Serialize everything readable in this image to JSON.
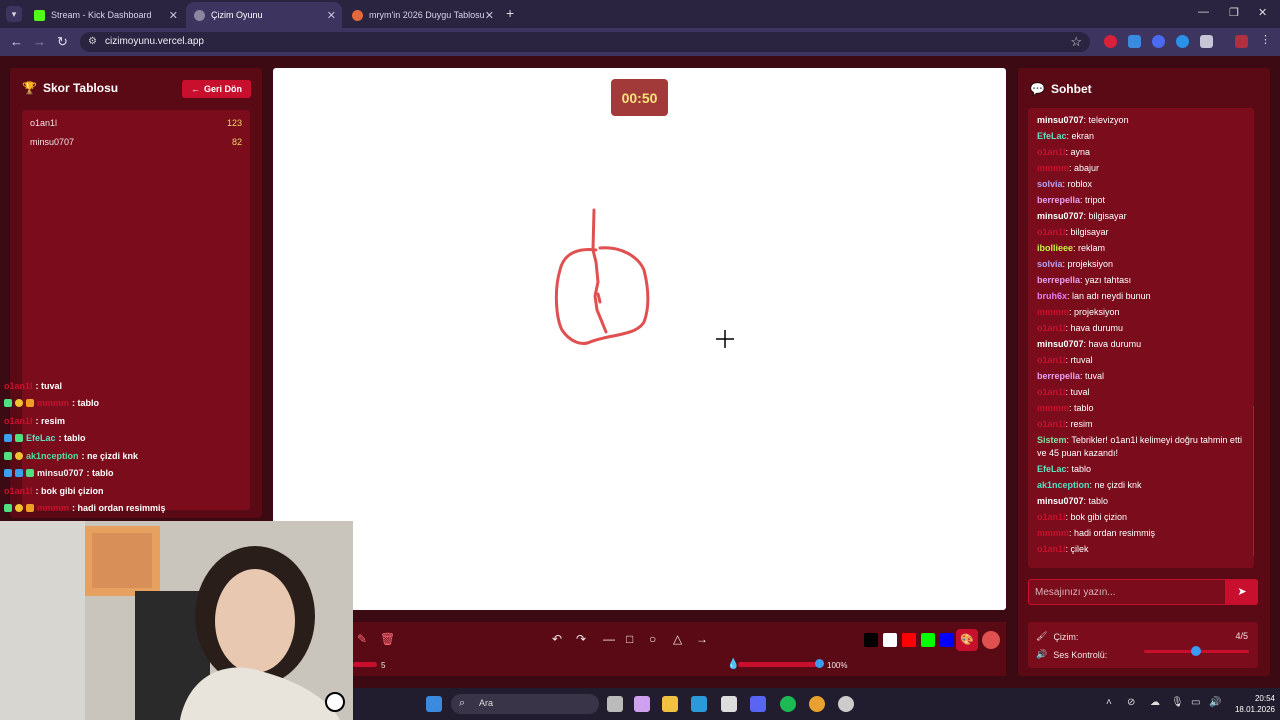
{
  "browser": {
    "tabs": [
      {
        "label": "Stream - Kick Dashboard",
        "fav_color": "#53fc18"
      },
      {
        "label": "Çizim Oyunu",
        "fav_color": "#8a86a0"
      },
      {
        "label": "mrym'in 2026 Duygu Tablosu",
        "fav_color": "#e26a3a"
      }
    ],
    "url": "cizimoyunu.vercel.app"
  },
  "scoreboard": {
    "title": "Skor Tablosu",
    "back_label": "Geri Dön",
    "players": [
      {
        "name": "o1an1l",
        "score": "123"
      },
      {
        "name": "minsu0707",
        "score": "82"
      }
    ]
  },
  "stream_chat": [
    {
      "user": "o1an1l",
      "color": "#c8102e",
      "text": ": tuval"
    },
    {
      "user": "mmmm",
      "color": "#c8102e",
      "text": ": tablo"
    },
    {
      "user": "o1an1l",
      "color": "#c8102e",
      "text": ": resim"
    },
    {
      "user": "EfeLac",
      "color": "#5fe0c0",
      "text": ": tablo"
    },
    {
      "user": "ak1nception",
      "color": "#4fe0a0",
      "text": ": ne çizdi knk"
    },
    {
      "user": "minsu0707",
      "color": "#f0f0f0",
      "text": ": tablo"
    },
    {
      "user": "o1an1l",
      "color": "#c8102e",
      "text": ": bok gibi çizion"
    },
    {
      "user": "mmmm",
      "color": "#c8102e",
      "text": ": hadi ordan resimmiş"
    }
  ],
  "game": {
    "timer": "00:50"
  },
  "toolbar": {
    "brush_size": "5",
    "opacity": "100%",
    "colors": [
      "#000000",
      "#ffffff",
      "#ff0000",
      "#00ff00",
      "#0000ff"
    ],
    "current_color": "#e05050"
  },
  "chat": {
    "title": "Sohbet",
    "messages": [
      {
        "user": "minsu0707",
        "color": "#ffffff",
        "text": "televizyon"
      },
      {
        "user": "EfeLac",
        "color": "#5fe0c0",
        "text": "ekran"
      },
      {
        "user": "o1an1l",
        "color": "#c8102e",
        "text": "ayna"
      },
      {
        "user": "mmmm",
        "color": "#c8102e",
        "text": "abajur"
      },
      {
        "user": "solvia",
        "color": "#b8a0f0",
        "text": "roblox"
      },
      {
        "user": "berrepella",
        "color": "#e8a0f0",
        "text": "tripot"
      },
      {
        "user": "minsu0707",
        "color": "#ffffff",
        "text": "bilgisayar"
      },
      {
        "user": "o1an1l",
        "color": "#c8102e",
        "text": "bilgisayar"
      },
      {
        "user": "ibollieee",
        "color": "#c8f040",
        "text": "reklam"
      },
      {
        "user": "solvia",
        "color": "#b8a0f0",
        "text": "projeksiyon"
      },
      {
        "user": "berrepella",
        "color": "#e8a0f0",
        "text": "yazı tahtası"
      },
      {
        "user": "bruh6x",
        "color": "#e080f0",
        "text": "lan adı neydi bunun"
      },
      {
        "user": "mmmm",
        "color": "#c8102e",
        "text": "projeksiyon"
      },
      {
        "user": "o1an1l",
        "color": "#c8102e",
        "text": "hava durumu"
      },
      {
        "user": "minsu0707",
        "color": "#ffffff",
        "text": "hava durumu"
      },
      {
        "user": "o1an1l",
        "color": "#c8102e",
        "text": "rtuval"
      },
      {
        "user": "berrepella",
        "color": "#e8a0f0",
        "text": "tuval"
      },
      {
        "user": "o1an1l",
        "color": "#c8102e",
        "text": "tuval"
      },
      {
        "user": "mmmm",
        "color": "#c8102e",
        "text": "tablo"
      },
      {
        "user": "o1an1l",
        "color": "#c8102e",
        "text": "resim"
      },
      {
        "user": "Sistem",
        "color": "#7fe0a0",
        "text": "Tebrikler! o1an1l kelimeyi doğru tahmin etti ve 45 puan kazandı!"
      },
      {
        "user": "EfeLac",
        "color": "#5fe0c0",
        "text": "tablo"
      },
      {
        "user": "ak1nception",
        "color": "#4fe0c0",
        "text": "ne çizdi knk"
      },
      {
        "user": "minsu0707",
        "color": "#ffffff",
        "text": "tablo"
      },
      {
        "user": "o1an1l",
        "color": "#c8102e",
        "text": "bok gibi çizion"
      },
      {
        "user": "mmmm",
        "color": "#c8102e",
        "text": "hadi ordan resimmiş"
      },
      {
        "user": "o1an1l",
        "color": "#c8102e",
        "text": "çilek"
      }
    ],
    "input_placeholder": "Mesajınızı yazın...",
    "drawing_label": "Çizim:",
    "drawing_value": "4/5",
    "volume_label": "Ses Kontrolü:",
    "volume_level": 0.45
  },
  "taskbar": {
    "search_label": "Ara",
    "time": "20:54",
    "date": "18.01.2026"
  }
}
